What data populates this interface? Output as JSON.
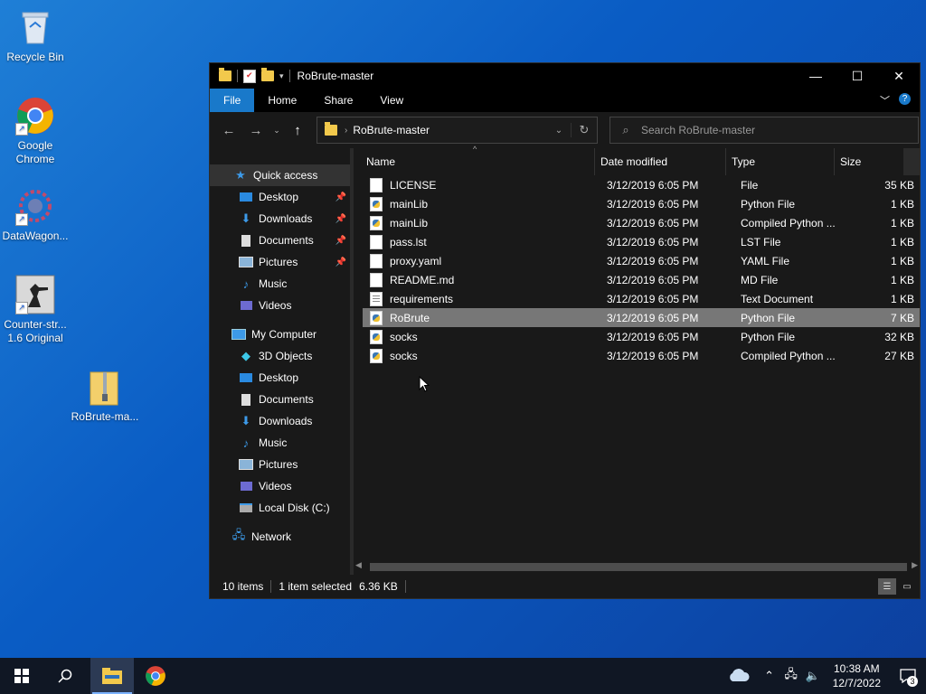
{
  "desktop": {
    "icons": [
      {
        "label": "Recycle Bin"
      },
      {
        "label": "Google Chrome"
      },
      {
        "label": "DataWagon..."
      },
      {
        "label": "Counter-str... 1.6 Original"
      },
      {
        "label": "RoBrute-ma..."
      }
    ]
  },
  "window": {
    "title": "RoBrute-master",
    "ribbon": {
      "file": "File",
      "home": "Home",
      "share": "Share",
      "view": "View"
    },
    "address": {
      "path": "RoBrute-master"
    },
    "search": {
      "placeholder": "Search RoBrute-master"
    },
    "nav": {
      "quick_access": "Quick access",
      "items": [
        "Desktop",
        "Downloads",
        "Documents",
        "Pictures",
        "Music",
        "Videos"
      ],
      "my_computer": "My Computer",
      "computer_items": [
        "3D Objects",
        "Desktop",
        "Documents",
        "Downloads",
        "Music",
        "Pictures",
        "Videos",
        "Local Disk (C:)"
      ],
      "network": "Network"
    },
    "columns": {
      "name": "Name",
      "date": "Date modified",
      "type": "Type",
      "size": "Size"
    },
    "files": [
      {
        "name": "LICENSE",
        "date": "3/12/2019 6:05 PM",
        "type": "File",
        "size": "35 KB",
        "icon": "file"
      },
      {
        "name": "mainLib",
        "date": "3/12/2019 6:05 PM",
        "type": "Python File",
        "size": "1 KB",
        "icon": "python"
      },
      {
        "name": "mainLib",
        "date": "3/12/2019 6:05 PM",
        "type": "Compiled Python ...",
        "size": "1 KB",
        "icon": "python"
      },
      {
        "name": "pass.lst",
        "date": "3/12/2019 6:05 PM",
        "type": "LST File",
        "size": "1 KB",
        "icon": "file"
      },
      {
        "name": "proxy.yaml",
        "date": "3/12/2019 6:05 PM",
        "type": "YAML File",
        "size": "1 KB",
        "icon": "file"
      },
      {
        "name": "README.md",
        "date": "3/12/2019 6:05 PM",
        "type": "MD File",
        "size": "1 KB",
        "icon": "file"
      },
      {
        "name": "requirements",
        "date": "3/12/2019 6:05 PM",
        "type": "Text Document",
        "size": "1 KB",
        "icon": "text"
      },
      {
        "name": "RoBrute",
        "date": "3/12/2019 6:05 PM",
        "type": "Python File",
        "size": "7 KB",
        "icon": "python",
        "selected": true
      },
      {
        "name": "socks",
        "date": "3/12/2019 6:05 PM",
        "type": "Python File",
        "size": "32 KB",
        "icon": "python"
      },
      {
        "name": "socks",
        "date": "3/12/2019 6:05 PM",
        "type": "Compiled Python ...",
        "size": "27 KB",
        "icon": "python"
      }
    ],
    "status": {
      "count": "10 items",
      "selected": "1 item selected",
      "size": "6.36 KB"
    }
  },
  "taskbar": {
    "time": "10:38 AM",
    "date": "12/7/2022",
    "notifications": "3"
  }
}
